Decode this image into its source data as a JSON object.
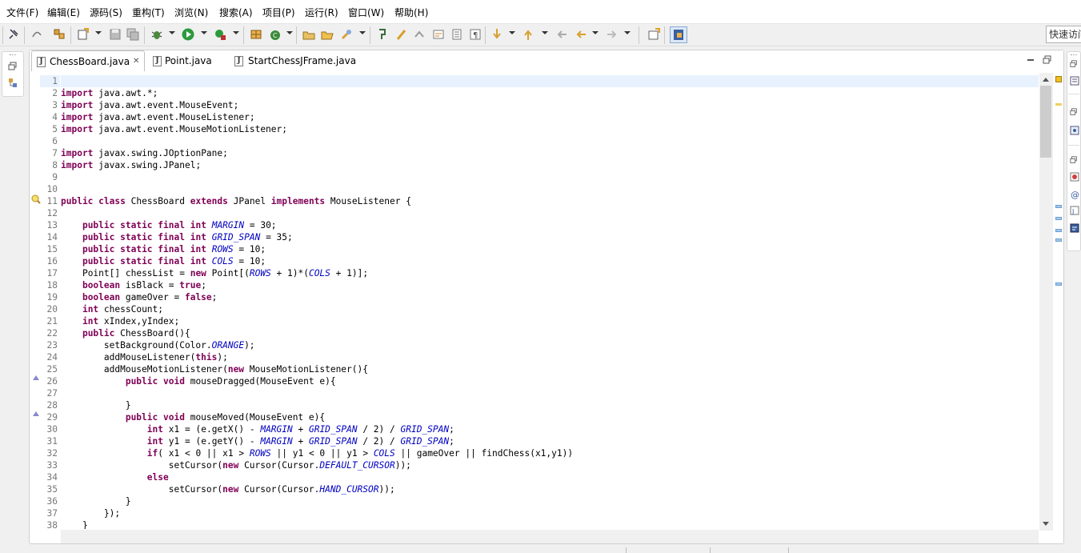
{
  "menu": [
    "文件(F)",
    "编辑(E)",
    "源码(S)",
    "重构(T)",
    "浏览(N)",
    "搜索(A)",
    "项目(P)",
    "运行(R)",
    "窗口(W)",
    "帮助(H)"
  ],
  "quick_access": {
    "placeholder": "快速访问"
  },
  "tabs": [
    {
      "label": "ChessBoard.java",
      "active": true,
      "closable": true
    },
    {
      "label": "Point.java",
      "active": false
    },
    {
      "label": "StartChessJFrame.java",
      "active": false
    }
  ],
  "code": {
    "current_line": 1,
    "lines": [
      "",
      "import java.awt.*;",
      "import java.awt.event.MouseEvent;",
      "import java.awt.event.MouseListener;",
      "import java.awt.event.MouseMotionListener;",
      "",
      "import javax.swing.JOptionPane;",
      "import javax.swing.JPanel;",
      "",
      "",
      "public class ChessBoard extends JPanel implements MouseListener {",
      "",
      "    public static final int MARGIN = 30;",
      "    public static final int GRID_SPAN = 35;",
      "    public static final int ROWS = 10;",
      "    public static final int COLS = 10;",
      "    Point[] chessList = new Point[(ROWS + 1)*(COLS + 1)];",
      "    boolean isBlack = true;",
      "    boolean gameOver = false;",
      "    int chessCount;",
      "    int xIndex,yIndex;",
      "    public ChessBoard(){",
      "        setBackground(Color.ORANGE);",
      "        addMouseListener(this);",
      "        addMouseMotionListener(new MouseMotionListener(){",
      "            public void mouseDragged(MouseEvent e){",
      "",
      "            }",
      "            public void mouseMoved(MouseEvent e){",
      "                int x1 = (e.getX() - MARGIN + GRID_SPAN / 2) / GRID_SPAN;",
      "                int y1 = (e.getY() - MARGIN + GRID_SPAN / 2) / GRID_SPAN;",
      "                if( x1 < 0 || x1 > ROWS || y1 < 0 || y1 > COLS || gameOver || findChess(x1,y1))",
      "                    setCursor(new Cursor(Cursor.DEFAULT_CURSOR));",
      "                else",
      "                    setCursor(new Cursor(Cursor.HAND_CURSOR));",
      "            }",
      "        });",
      "    }"
    ],
    "line_numbers": [
      "1",
      "2",
      "3",
      "4",
      "5",
      "6",
      "7",
      "8",
      "9",
      "10",
      "11",
      "12",
      "13",
      "14",
      "15",
      "16",
      "17",
      "18",
      "19",
      "20",
      "21",
      "22",
      "23",
      "24",
      "25",
      "26",
      "27",
      "28",
      "29",
      "30",
      "31",
      "32",
      "33",
      "34",
      "35",
      "36",
      "37",
      "38"
    ],
    "keywords": [
      "import",
      "public",
      "class",
      "extends",
      "implements",
      "static",
      "final",
      "int",
      "boolean",
      "true",
      "false",
      "new",
      "void",
      "this",
      "if",
      "else"
    ],
    "fields": [
      "MARGIN",
      "GRID_SPAN",
      "ROWS",
      "COLS",
      "ORANGE",
      "DEFAULT_CURSOR",
      "HAND_CURSOR"
    ],
    "keyword_color": "#7f0055",
    "field_color": "#0000c0"
  }
}
